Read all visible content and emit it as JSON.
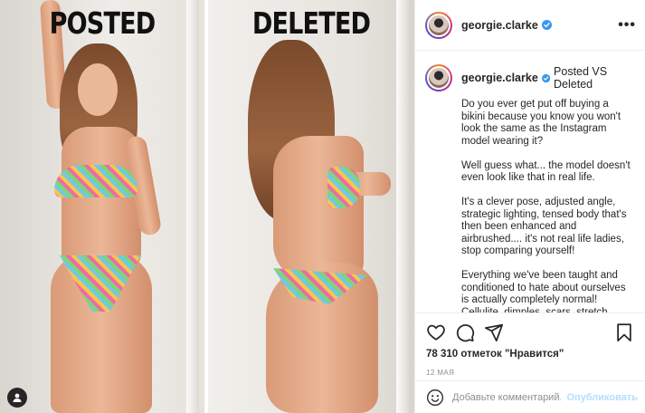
{
  "photo": {
    "left_label": "POSTED",
    "right_label": "DELETED"
  },
  "header": {
    "username": "georgie.clarke",
    "verified": true,
    "more_icon": "more-horizontal-icon"
  },
  "caption": {
    "username": "georgie.clarke",
    "title": "Posted VS Deleted",
    "paragraphs": [
      "Do you ever get put off buying a bikini because you know you won't look the same as the Instagram model wearing it?",
      "Well guess what... the model doesn't even look like that in real life.",
      "It's a clever pose, adjusted angle, strategic lighting, tensed body that's then been enhanced and airbrushed.... it's not real life ladies, stop comparing yourself!",
      "Everything we've been taught and conditioned to hate about ourselves is actually completely normal! Cellulite, dimples, scars, stretch marks... rolls..."
    ]
  },
  "actions": {
    "icons": [
      "heart-icon",
      "comment-icon",
      "share-icon",
      "bookmark-icon"
    ],
    "likes": "78 310 отметок \"Нравится\"",
    "date": "12 МАЯ"
  },
  "comment": {
    "placeholder": "Добавьте комментарий...",
    "publish_label": "Опубликовать"
  },
  "colors": {
    "verified": "#3897f0",
    "publish_disabled": "#b2dffc",
    "secondary_text": "#8e8e8e"
  }
}
